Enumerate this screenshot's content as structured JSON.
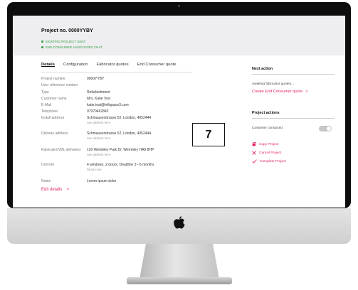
{
  "project": {
    "title": "Project no. 0000YYBY",
    "status_1": "EXISTING PROJECT SENT",
    "status_2": "END CONSUMER ASSOCIATED CHAT"
  },
  "tabs": [
    "Details",
    "Configuration",
    "Fabricator quotes",
    "End Consumer quote"
  ],
  "details": [
    {
      "label": "Project number",
      "value": "0000YYBY"
    },
    {
      "label": "User reference number",
      "value": ""
    },
    {
      "label": "Type",
      "value": "Refurbishment"
    },
    {
      "label": "Customer name",
      "value": "Mrs. Katie Test"
    },
    {
      "label": "E-Mail",
      "value": "katie.test@leftspace3.com"
    },
    {
      "label": "Telephone",
      "value": "07979462842"
    },
    {
      "label": "Install address",
      "value": "Schmauserstrasse 52, London, 4052444",
      "sub": "See address here"
    },
    {
      "label": "Delivery address",
      "value": "Schmauserstrasse 52, London, 4052444",
      "sub": "See address here"
    },
    {
      "label": "Fabricator/VBL deliveries",
      "value": "120 Wembley Park Dr, Wembley HA9 8HP",
      "sub": "See address here"
    },
    {
      "label": "Unit info",
      "value": "4 windows, 2 doors. Deadline 3 - 6 months",
      "sub": "Read more"
    },
    {
      "label": "Notes",
      "value": "Lorem ipsum dolor"
    }
  ],
  "edit_link": {
    "label": "Edit details",
    "chevron": ">"
  },
  "annotation_number": "7",
  "next_action": {
    "heading": "Next action",
    "text": "Awaiting fabricator quotes...",
    "link": "Create End Consumer quote",
    "chevron": ">"
  },
  "project_actions": {
    "heading": "Project actions",
    "toggle_label": "Customer contacted",
    "toggle_on": false,
    "actions": [
      {
        "label": "Copy Project",
        "icon": "copy-icon"
      },
      {
        "label": "Cancel Project",
        "icon": "close-icon"
      },
      {
        "label": "Complete Project",
        "icon": "check-icon"
      }
    ]
  },
  "colors": {
    "accent": "#e5226b",
    "status_green": "#2e9c3f",
    "header_bg": "#eeeef0",
    "bezel": "#0d0d0d"
  }
}
